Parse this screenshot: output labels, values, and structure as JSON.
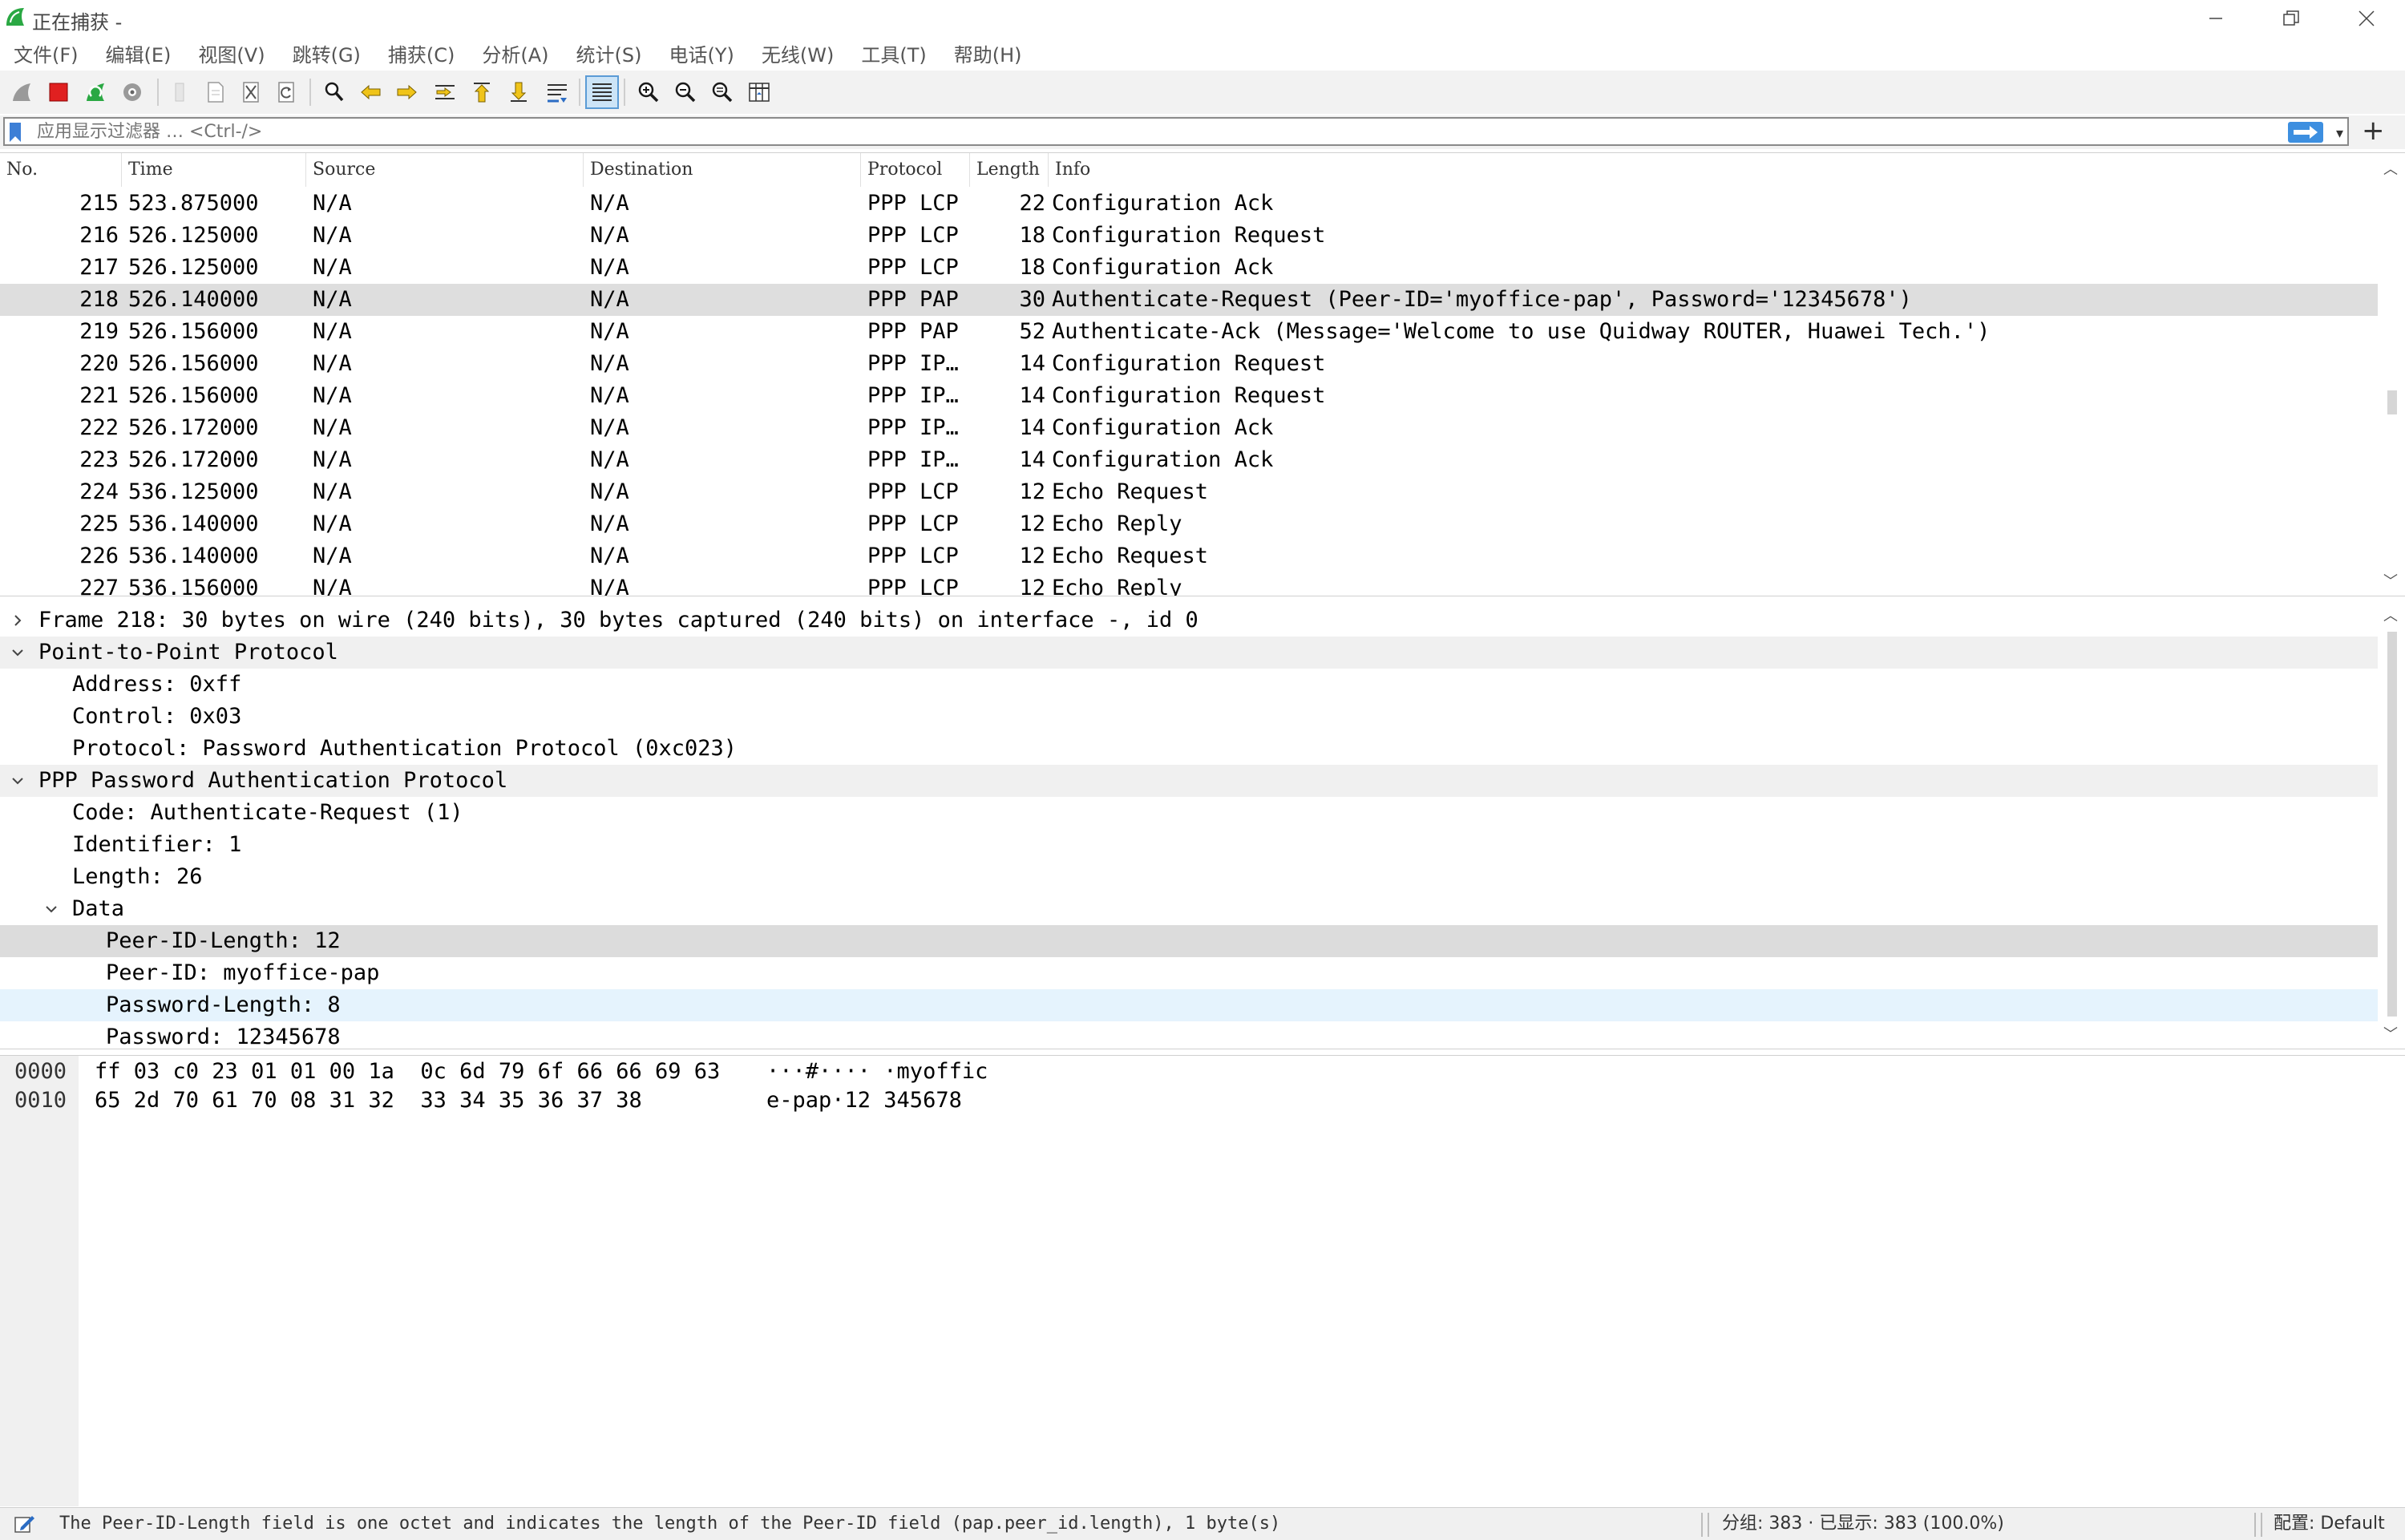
{
  "window": {
    "title": "正在捕获 -"
  },
  "menu": [
    "文件(F)",
    "编辑(E)",
    "视图(V)",
    "跳转(G)",
    "捕获(C)",
    "分析(A)",
    "统计(S)",
    "电话(Y)",
    "无线(W)",
    "工具(T)",
    "帮助(H)"
  ],
  "filter": {
    "placeholder": "应用显示过滤器 … <Ctrl-/>"
  },
  "packet_list": {
    "columns": [
      "No.",
      "Time",
      "Source",
      "Destination",
      "Protocol",
      "Length",
      "Info"
    ],
    "rows": [
      {
        "no": "215",
        "time": "523.875000",
        "src": "N/A",
        "dst": "N/A",
        "proto": "PPP LCP",
        "len": "22",
        "info": "Configuration Ack"
      },
      {
        "no": "216",
        "time": "526.125000",
        "src": "N/A",
        "dst": "N/A",
        "proto": "PPP LCP",
        "len": "18",
        "info": "Configuration Request"
      },
      {
        "no": "217",
        "time": "526.125000",
        "src": "N/A",
        "dst": "N/A",
        "proto": "PPP LCP",
        "len": "18",
        "info": "Configuration Ack"
      },
      {
        "no": "218",
        "time": "526.140000",
        "src": "N/A",
        "dst": "N/A",
        "proto": "PPP PAP",
        "len": "30",
        "info": "Authenticate-Request (Peer-ID='myoffice-pap', Password='12345678')"
      },
      {
        "no": "219",
        "time": "526.156000",
        "src": "N/A",
        "dst": "N/A",
        "proto": "PPP PAP",
        "len": "52",
        "info": "Authenticate-Ack (Message='Welcome to use Quidway ROUTER, Huawei Tech.')"
      },
      {
        "no": "220",
        "time": "526.156000",
        "src": "N/A",
        "dst": "N/A",
        "proto": "PPP IP…",
        "len": "14",
        "info": "Configuration Request"
      },
      {
        "no": "221",
        "time": "526.156000",
        "src": "N/A",
        "dst": "N/A",
        "proto": "PPP IP…",
        "len": "14",
        "info": "Configuration Request"
      },
      {
        "no": "222",
        "time": "526.172000",
        "src": "N/A",
        "dst": "N/A",
        "proto": "PPP IP…",
        "len": "14",
        "info": "Configuration Ack"
      },
      {
        "no": "223",
        "time": "526.172000",
        "src": "N/A",
        "dst": "N/A",
        "proto": "PPP IP…",
        "len": "14",
        "info": "Configuration Ack"
      },
      {
        "no": "224",
        "time": "536.125000",
        "src": "N/A",
        "dst": "N/A",
        "proto": "PPP LCP",
        "len": "12",
        "info": "Echo Request"
      },
      {
        "no": "225",
        "time": "536.140000",
        "src": "N/A",
        "dst": "N/A",
        "proto": "PPP LCP",
        "len": "12",
        "info": "Echo Reply"
      },
      {
        "no": "226",
        "time": "536.140000",
        "src": "N/A",
        "dst": "N/A",
        "proto": "PPP LCP",
        "len": "12",
        "info": "Echo Request"
      },
      {
        "no": "227",
        "time": "536.156000",
        "src": "N/A",
        "dst": "N/A",
        "proto": "PPP LCP",
        "len": "12",
        "info": "Echo Reply"
      }
    ],
    "selected_no": "218"
  },
  "details": [
    {
      "text": "Frame 218: 30 bytes on wire (240 bits), 30 bytes captured (240 bits) on interface -, id 0",
      "level": 0,
      "caret": "collapsed",
      "style": "plain"
    },
    {
      "text": "Point-to-Point Protocol",
      "level": 0,
      "caret": "expanded",
      "style": "section"
    },
    {
      "text": "Address: 0xff",
      "level": 1,
      "caret": "none",
      "style": "plain"
    },
    {
      "text": "Control: 0x03",
      "level": 1,
      "caret": "none",
      "style": "plain"
    },
    {
      "text": "Protocol: Password Authentication Protocol (0xc023)",
      "level": 1,
      "caret": "none",
      "style": "plain"
    },
    {
      "text": "PPP Password Authentication Protocol",
      "level": 0,
      "caret": "expanded",
      "style": "section"
    },
    {
      "text": "Code: Authenticate-Request (1)",
      "level": 1,
      "caret": "none",
      "style": "plain"
    },
    {
      "text": "Identifier: 1",
      "level": 1,
      "caret": "none",
      "style": "plain"
    },
    {
      "text": "Length: 26",
      "level": 1,
      "caret": "none",
      "style": "plain"
    },
    {
      "text": "Data",
      "level": 1,
      "caret": "expanded",
      "style": "plain"
    },
    {
      "text": "Peer-ID-Length: 12",
      "level": 2,
      "caret": "none",
      "style": "selected"
    },
    {
      "text": "Peer-ID: myoffice-pap",
      "level": 2,
      "caret": "none",
      "style": "plain"
    },
    {
      "text": "Password-Length: 8",
      "level": 2,
      "caret": "none",
      "style": "hover"
    },
    {
      "text": "Password: 12345678",
      "level": 2,
      "caret": "none",
      "style": "plain"
    }
  ],
  "bytes": [
    {
      "offset": "0000",
      "hex": "ff 03 c0 23 01 01 00 1a  0c 6d 79 6f 66 66 69 63",
      "ascii": "···#···· ·myoffic"
    },
    {
      "offset": "0010",
      "hex": "65 2d 70 61 70 08 31 32  33 34 35 36 37 38",
      "ascii": "e-pap·12 345678"
    }
  ],
  "status": {
    "field_info": "The Peer-ID-Length field is one octet and indicates the length of the Peer-ID field (pap.peer_id.length), 1 byte(s)",
    "packets": "分组: 383 · 已显示: 383 (100.0%)",
    "profile": "配置: Default"
  },
  "colors": {
    "selected_row": "#dedede",
    "section_bg": "#f0f0f0",
    "hover_row": "#e5f3fd",
    "apply_button": "#3d8fe0",
    "stop_button": "#e02020",
    "logo_green": "#2aa843"
  },
  "toolbar_icons": [
    "shark-fin-start-icon",
    "stop-capture-icon",
    "restart-capture-icon",
    "capture-options-icon",
    "open-file-icon",
    "save-file-icon",
    "close-file-icon",
    "reload-file-icon",
    "find-packet-icon",
    "go-back-icon",
    "go-forward-icon",
    "go-to-packet-icon",
    "go-first-icon",
    "go-last-icon",
    "autoscroll-icon",
    "colorize-icon",
    "zoom-in-icon",
    "zoom-out-icon",
    "zoom-normal-icon",
    "resize-columns-icon"
  ]
}
